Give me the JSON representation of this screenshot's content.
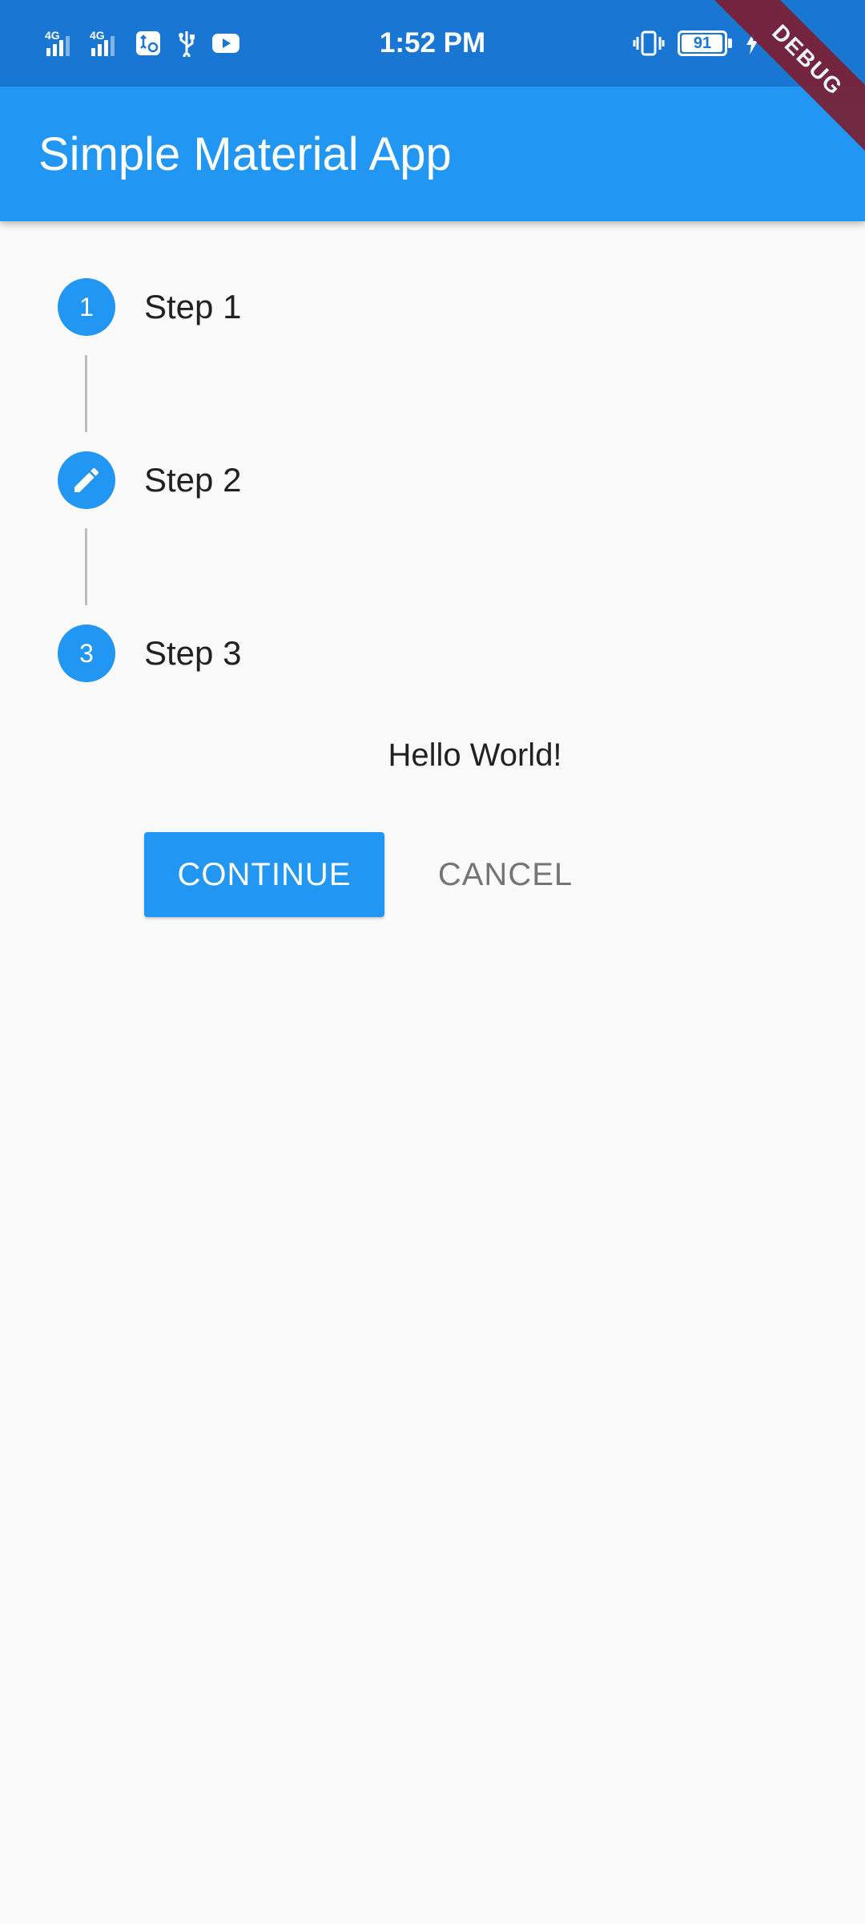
{
  "status_bar": {
    "time": "1:52 PM",
    "signal_1": "4G",
    "signal_2": "4G",
    "battery_level": "91",
    "battery_fraction": 0.91,
    "icons": [
      "signal-4g-icon",
      "signal-4g-icon",
      "usb-settings-icon",
      "usb-icon",
      "youtube-icon",
      "vibrate-icon",
      "battery-icon",
      "charging-bolt-icon"
    ]
  },
  "debug_banner": "DEBUG",
  "app_bar": {
    "title": "Simple Material App"
  },
  "stepper": {
    "steps": [
      {
        "index_label": "1",
        "title": "Step 1",
        "state": "indexed"
      },
      {
        "index_label": "",
        "title": "Step 2",
        "state": "editing",
        "icon": "pencil-icon"
      },
      {
        "index_label": "3",
        "title": "Step 3",
        "state": "indexed"
      }
    ],
    "content": "Hello World!",
    "continue_label": "CONTINUE",
    "cancel_label": "CANCEL"
  },
  "colors": {
    "status_bar": "#1976d2",
    "primary": "#2196f3",
    "background": "#fafafa",
    "debug_banner": "#7b1f33",
    "cancel_text": "#757575"
  }
}
